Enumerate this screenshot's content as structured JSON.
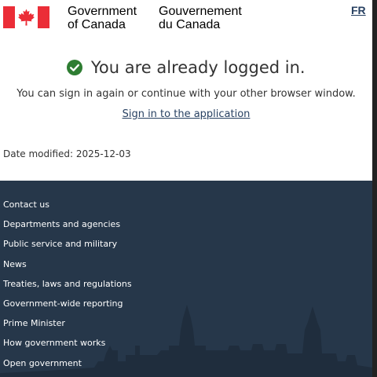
{
  "header": {
    "signature_en_line1": "Government",
    "signature_en_line2": "of Canada",
    "signature_fr_line1": "Gouvernement",
    "signature_fr_line2": "du Canada",
    "language_toggle": "FR",
    "flag_colors": {
      "red": "#eb2d37",
      "white": "#ffffff"
    }
  },
  "main": {
    "title": "You are already logged in.",
    "subtitle": "You can sign in again or continue with your other browser window.",
    "signin_link": "Sign in to the application",
    "date_modified": "Date modified: 2025-12-03",
    "status_icon": "check-circle-icon",
    "status_color": "#2e7d32"
  },
  "footer": {
    "background": "#26374a",
    "links": [
      "Contact us",
      "Departments and agencies",
      "Public service and military",
      "News",
      "Treaties, laws and regulations",
      "Government-wide reporting",
      "Prime Minister",
      "How government works",
      "Open government"
    ]
  }
}
